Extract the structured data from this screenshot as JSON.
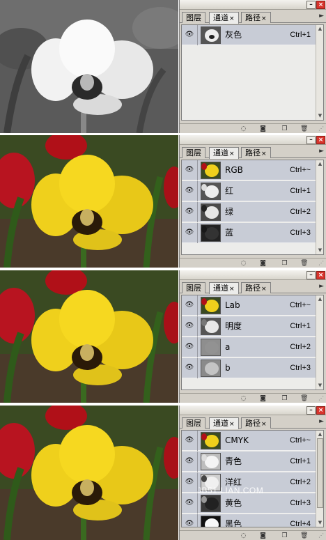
{
  "tabs": [
    {
      "label": "图层",
      "active": false
    },
    {
      "label": "通道",
      "active": true
    },
    {
      "label": "路径",
      "active": false
    }
  ],
  "panels": [
    {
      "mode": "grayscale",
      "channels": [
        {
          "name": "灰色",
          "shortcut": "Ctrl+1"
        }
      ]
    },
    {
      "mode": "rgb",
      "channels": [
        {
          "name": "RGB",
          "shortcut": "Ctrl+~"
        },
        {
          "name": "红",
          "shortcut": "Ctrl+1"
        },
        {
          "name": "绿",
          "shortcut": "Ctrl+2"
        },
        {
          "name": "蓝",
          "shortcut": "Ctrl+3"
        }
      ]
    },
    {
      "mode": "lab",
      "channels": [
        {
          "name": "Lab",
          "shortcut": "Ctrl+~"
        },
        {
          "name": "明度",
          "shortcut": "Ctrl+1"
        },
        {
          "name": "a",
          "shortcut": "Ctrl+2"
        },
        {
          "name": "b",
          "shortcut": "Ctrl+3"
        }
      ]
    },
    {
      "mode": "cmyk",
      "channels": [
        {
          "name": "CMYK",
          "shortcut": "Ctrl+~"
        },
        {
          "name": "青色",
          "shortcut": "Ctrl+1"
        },
        {
          "name": "洋红",
          "shortcut": "Ctrl+2"
        },
        {
          "name": "黄色",
          "shortcut": "Ctrl+3"
        },
        {
          "name": "黑色",
          "shortcut": "Ctrl+4"
        }
      ]
    }
  ],
  "watermark": "JB51.LIAN.COM",
  "icons": {
    "eye": "eye-icon",
    "load_selection": "dotted-circle-icon",
    "save_selection": "mask-icon",
    "new_channel": "new-channel-icon",
    "delete": "trash-icon",
    "minimize": "minimize-icon",
    "close": "close-icon",
    "menu": "panel-menu-icon"
  },
  "colors": {
    "panel_bg": "#d4d0c8",
    "row_selected": "#c8ccd6",
    "close_red": "#d8342c",
    "tulip_yellow": "#f2d21a",
    "tulip_red": "#c0141c"
  }
}
